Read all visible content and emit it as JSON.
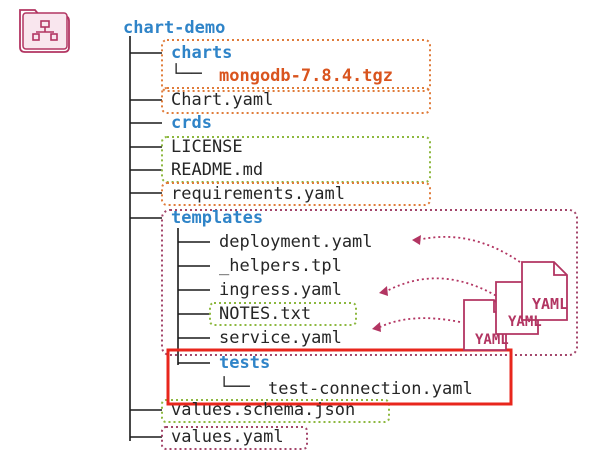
{
  "colors": {
    "orange_dotted": "#e07c3a",
    "green_dotted": "#8db83f",
    "purple_dotted": "#a3456a",
    "highlight_red": "#e8261c",
    "folder_icon": "#b23562",
    "dir_blue": "#2f84c8",
    "pkg_orange": "#d9541e"
  },
  "icons": {
    "root": "folder-tree-icon",
    "yaml_doc": "yaml-document-icon"
  },
  "tree": {
    "root": "chart-demo",
    "charts": "charts",
    "mongodb": "mongodb-7.8.4.tgz",
    "chart_yaml": "Chart.yaml",
    "crds": "crds",
    "license": "LICENSE",
    "readme": "README.md",
    "requirements": "requirements.yaml",
    "templates": "templates",
    "deployment": "deployment.yaml",
    "helpers": "_helpers.tpl",
    "ingress": "ingress.yaml",
    "notes": "NOTES.txt",
    "service": "service.yaml",
    "tests": "tests",
    "test_connection": "test-connection.yaml",
    "values_schema": "values.schema.json",
    "values": "values.yaml"
  },
  "yaml_label": "YAML"
}
